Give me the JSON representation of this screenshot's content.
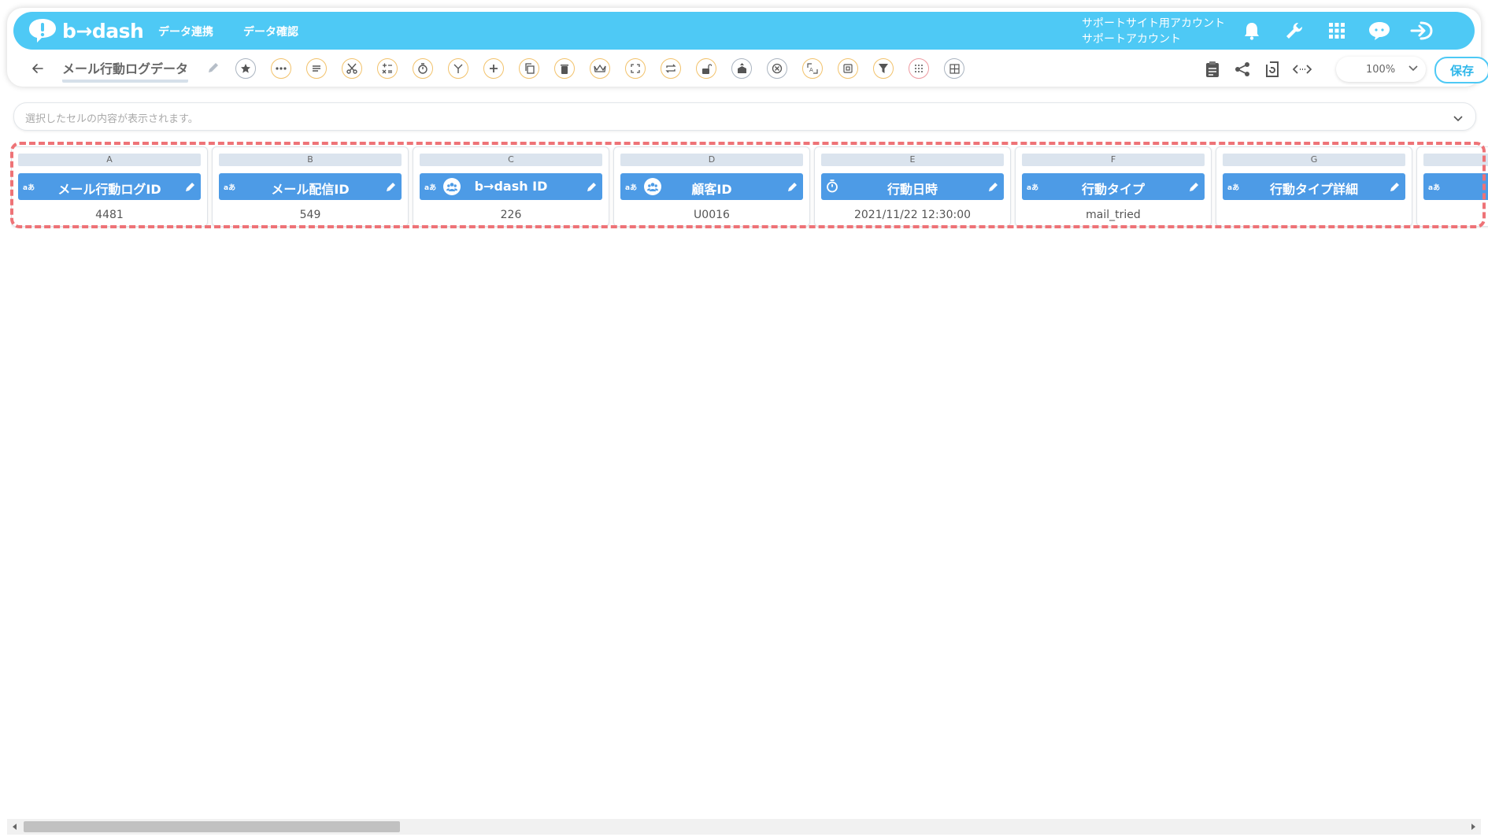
{
  "app": {
    "name": "b→dash"
  },
  "nav": [
    {
      "label": "データ連携"
    },
    {
      "label": "データ確認"
    }
  ],
  "account": {
    "line1": "サポートサイト用アカウント",
    "line2": "サポートアカウント"
  },
  "top_icons": [
    "bell-icon",
    "wrench-icon",
    "apps-grid-icon",
    "chat-icon",
    "logout-icon"
  ],
  "toolbar": {
    "title": "メール行動ログデータ",
    "tools": [
      "star-icon",
      "more-icon",
      "list-icon",
      "scissors-icon",
      "calc-icon",
      "timer-icon",
      "branch-icon",
      "plus-icon",
      "copy-icon",
      "trash-icon",
      "crown-icon",
      "expand-icon",
      "repeat-icon",
      "lock-icon",
      "upload-icon",
      "close-circle-icon",
      "replace-icon",
      "box-icon",
      "filter-icon",
      "dots-grid-icon",
      "table-icon"
    ],
    "right_icons": [
      "clipboard-icon",
      "share-icon",
      "history-icon",
      "code-icon"
    ],
    "zoom": "100%",
    "save_label": "保存"
  },
  "cell_bar": {
    "placeholder": "選択したセルの内容が表示されます。"
  },
  "columns": [
    {
      "letter": "A",
      "type": "aあ",
      "name": "メール行動ログID",
      "value": "4481",
      "icon": "text-type"
    },
    {
      "letter": "B",
      "type": "aあ",
      "name": "メール配信ID",
      "value": "549",
      "icon": "text-type"
    },
    {
      "letter": "C",
      "type": "aあ",
      "name": "b→dash ID",
      "value": "226",
      "icon": "people-id"
    },
    {
      "letter": "D",
      "type": "aあ",
      "name": "顧客ID",
      "value": "U0016",
      "icon": "people-id"
    },
    {
      "letter": "E",
      "type": "",
      "name": "行動日時",
      "value": "2021/11/22 12:30:00",
      "icon": "timer"
    },
    {
      "letter": "F",
      "type": "aあ",
      "name": "行動タイプ",
      "value": "mail_tried",
      "icon": "text-type"
    },
    {
      "letter": "G",
      "type": "aあ",
      "name": "行動タイプ詳細",
      "value": "",
      "icon": "text-type"
    },
    {
      "letter": "",
      "type": "aあ",
      "name": "",
      "value": "",
      "icon": "text-type"
    }
  ],
  "colors": {
    "topbar": "#4ec9f5",
    "header": "#4d9be6",
    "highlight": "#ee7377"
  }
}
